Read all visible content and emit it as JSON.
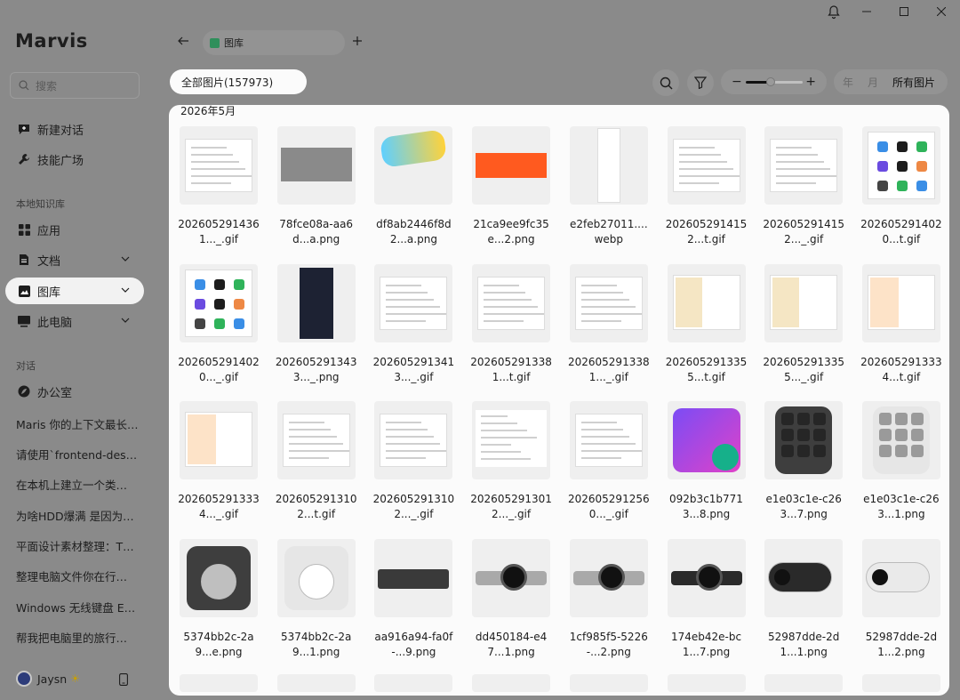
{
  "app": {
    "name": "Marvis"
  },
  "search": {
    "placeholder": "搜索"
  },
  "nav": {
    "new_chat": "新建对话",
    "skills": "技能广场",
    "section_local": "本地知识库",
    "apps": "应用",
    "docs": "文档",
    "gallery": "图库",
    "this_pc": "此电脑",
    "section_chat": "对话",
    "office": "办公室"
  },
  "conversations": [
    "Maris 你的上下文最长…",
    "请使用`frontend-des…",
    "在本机上建立一个类…",
    "为啥HDD爆满 是因为…",
    "平面设计素材整理：T…",
    "整理电脑文件你在行…",
    "Windows 无线键盘 E…",
    "帮我把电脑里的旅行…"
  ],
  "user": {
    "name": "Jaysn"
  },
  "tab": {
    "label": "图库"
  },
  "toolbar": {
    "all_images": "全部图片(157973)",
    "year": "年",
    "month": "月",
    "all_pictures": "所有图片",
    "zoom_level": 0.45
  },
  "gallery": {
    "month": "2026年5月",
    "items": [
      {
        "l1": "202605291436",
        "l2": "1..._.gif",
        "kind": "shot"
      },
      {
        "l1": "78fce08a-aa6",
        "l2": "d...a.png",
        "kind": "doc"
      },
      {
        "l1": "df8ab2446f8d",
        "l2": "2...a.png",
        "kind": "sticker"
      },
      {
        "l1": "21ca9ee9fc35",
        "l2": "e...2.png",
        "kind": "banner"
      },
      {
        "l1": "e2feb27011....",
        "l2": "webp",
        "kind": "long"
      },
      {
        "l1": "202605291415",
        "l2": "2...t.gif",
        "kind": "shot"
      },
      {
        "l1": "202605291415",
        "l2": "2..._.gif",
        "kind": "shot"
      },
      {
        "l1": "202605291402",
        "l2": "0...t.gif",
        "kind": "apps"
      },
      {
        "l1": "202605291402",
        "l2": "0..._.gif",
        "kind": "apps"
      },
      {
        "l1": "202605291343",
        "l2": "3..._.png",
        "kind": "darkpage"
      },
      {
        "l1": "202605291341",
        "l2": "3..._.gif",
        "kind": "shot"
      },
      {
        "l1": "202605291338",
        "l2": "1...t.gif",
        "kind": "shot"
      },
      {
        "l1": "202605291338",
        "l2": "1..._.gif",
        "kind": "shot"
      },
      {
        "l1": "202605291335",
        "l2": "5...t.gif",
        "kind": "poster"
      },
      {
        "l1": "202605291335",
        "l2": "5..._.gif",
        "kind": "poster"
      },
      {
        "l1": "202605291333",
        "l2": "4...t.gif",
        "kind": "poster2"
      },
      {
        "l1": "202605291333",
        "l2": "4..._.gif",
        "kind": "poster2"
      },
      {
        "l1": "202605291310",
        "l2": "2...t.gif",
        "kind": "shot"
      },
      {
        "l1": "202605291310",
        "l2": "2..._.gif",
        "kind": "shot"
      },
      {
        "l1": "202605291301",
        "l2": "2..._.gif",
        "kind": "doc2"
      },
      {
        "l1": "202605291256",
        "l2": "0..._.gif",
        "kind": "shot"
      },
      {
        "l1": "092b3c1b771",
        "l2": "3...8.png",
        "kind": "logo"
      },
      {
        "l1": "e1e03c1e-c26",
        "l2": "3...7.png",
        "kind": "keypad-dark"
      },
      {
        "l1": "e1e03c1e-c26",
        "l2": "3...1.png",
        "kind": "keypad-light"
      },
      {
        "l1": "5374bb2c-2a",
        "l2": "9...e.png",
        "kind": "dial-dark"
      },
      {
        "l1": "5374bb2c-2a",
        "l2": "9...1.png",
        "kind": "dial-light"
      },
      {
        "l1": "aa916a94-fa0f",
        "l2": "-...9.png",
        "kind": "keyboard"
      },
      {
        "l1": "dd450184-e4",
        "l2": "7...1.png",
        "kind": "cam-gray"
      },
      {
        "l1": "1cf985f5-5226",
        "l2": "-...2.png",
        "kind": "cam-gray"
      },
      {
        "l1": "174eb42e-bc",
        "l2": "1...7.png",
        "kind": "cam-dark"
      },
      {
        "l1": "52987dde-2d",
        "l2": "1...1.png",
        "kind": "webcam-dark"
      },
      {
        "l1": "52987dde-2d",
        "l2": "1...2.png",
        "kind": "webcam-light"
      }
    ]
  },
  "colors": {
    "accent_green": "#2f8f5b",
    "overlay": "#8a8a8a",
    "panel": "#fbfbfb"
  }
}
